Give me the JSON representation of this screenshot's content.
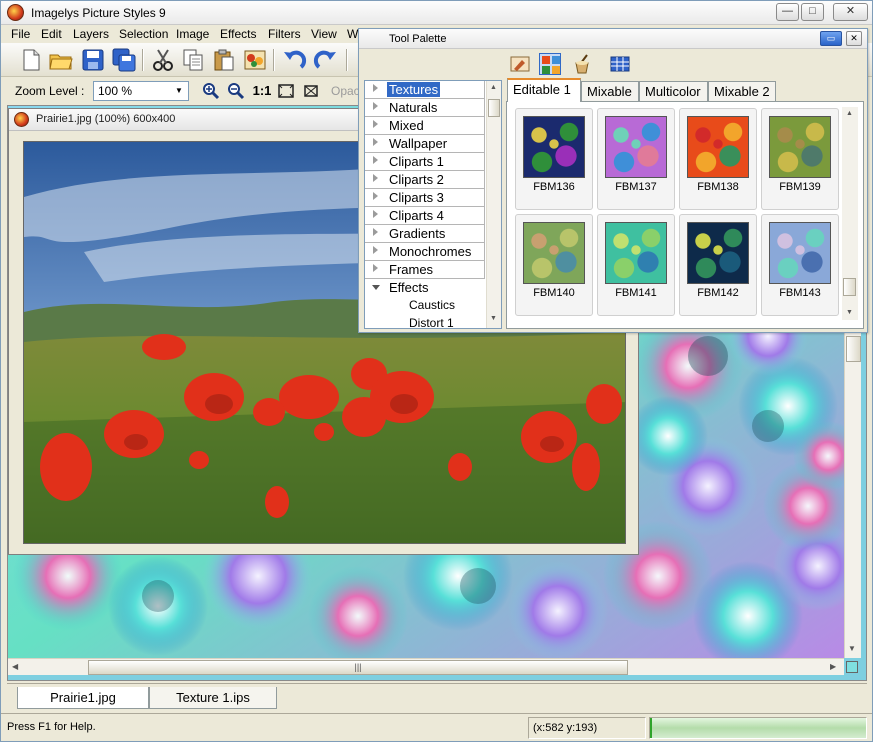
{
  "window": {
    "title": "Imagelys Picture Styles 9",
    "min_glyph": "—",
    "max_glyph": "□",
    "close_glyph": "✕"
  },
  "menu": [
    {
      "label": "File",
      "key": "F"
    },
    {
      "label": "Edit",
      "key": "E"
    },
    {
      "label": "Layers",
      "key": "L"
    },
    {
      "label": "Selection",
      "key": "S"
    },
    {
      "label": "Image",
      "key": "I"
    },
    {
      "label": "Effects",
      "key": "f"
    },
    {
      "label": "Filters",
      "key": "t"
    },
    {
      "label": "View",
      "key": "V"
    },
    {
      "label": "W",
      "key": "W"
    }
  ],
  "zoom": {
    "label": "Zoom Level :",
    "value": "100 %",
    "one_to_one": "1:1",
    "opacity_label": "Opac"
  },
  "document": {
    "title": "Prairie1.jpg (100%) 600x400"
  },
  "palette": {
    "title": "Tool Palette",
    "tree": [
      {
        "label": "Textures",
        "selected": true
      },
      {
        "label": "Naturals"
      },
      {
        "label": "Mixed"
      },
      {
        "label": "Wallpaper"
      },
      {
        "label": "Cliparts 1"
      },
      {
        "label": "Cliparts 2"
      },
      {
        "label": "Cliparts 3"
      },
      {
        "label": "Cliparts 4"
      },
      {
        "label": "Gradients"
      },
      {
        "label": "Monochromes"
      },
      {
        "label": "Frames"
      },
      {
        "label": "Effects",
        "expanded": true
      }
    ],
    "tree_children": [
      "Caustics",
      "Distort 1"
    ],
    "tabs": [
      "Editable 1",
      "Mixable",
      "Multicolor",
      "Mixable 2"
    ],
    "active_tab": "Editable 1",
    "swatches": [
      {
        "name": "FBM136",
        "colors": [
          "#1b2a6e",
          "#2f8f3a",
          "#9a2fb8",
          "#d8c24a"
        ]
      },
      {
        "name": "FBM137",
        "colors": [
          "#b86ad6",
          "#3f8fd8",
          "#e07a9a",
          "#6fd0b8"
        ]
      },
      {
        "name": "FBM138",
        "colors": [
          "#e84b1a",
          "#f2a52b",
          "#3a8f5a",
          "#d22a2a"
        ]
      },
      {
        "name": "FBM139",
        "colors": [
          "#7b9a3c",
          "#c8b94a",
          "#4f7a6a",
          "#a58c4a"
        ]
      },
      {
        "name": "FBM140",
        "colors": [
          "#7fa65a",
          "#b8c46a",
          "#4f8fa0",
          "#c8a070"
        ]
      },
      {
        "name": "FBM141",
        "colors": [
          "#3fc0a0",
          "#8ad06a",
          "#2f80b0",
          "#c0e070"
        ]
      },
      {
        "name": "FBM142",
        "colors": [
          "#0e2a4a",
          "#2f8a5a",
          "#1a5a7a",
          "#c8d04a"
        ]
      },
      {
        "name": "FBM143",
        "colors": [
          "#8aa8d8",
          "#6ad0c0",
          "#4a70b0",
          "#d0c0e0"
        ]
      }
    ]
  },
  "doc_tabs": [
    "Prairie1.jpg",
    "Texture 1.ips"
  ],
  "status": {
    "help": "Press F1 for Help.",
    "coords": "(x:582 y:193)"
  },
  "colors": {
    "selection": "#3169c6",
    "tab_accent": "#e68b2c",
    "texture_base": "#7ecfe0"
  }
}
